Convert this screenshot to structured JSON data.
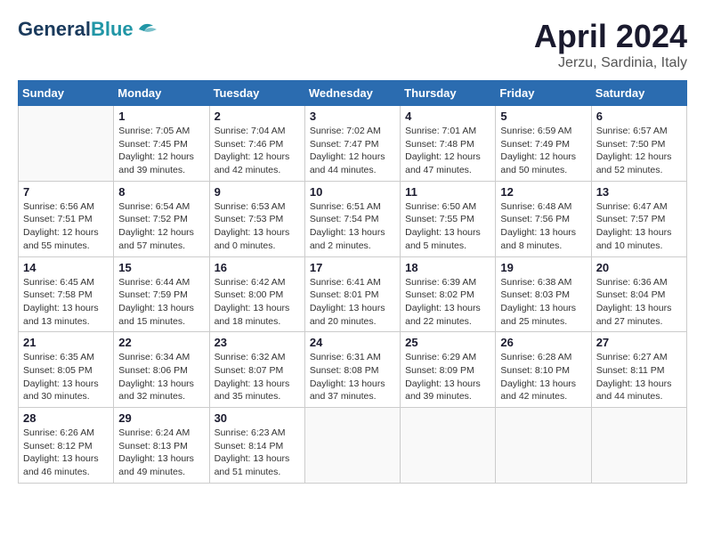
{
  "header": {
    "logo_general": "General",
    "logo_blue": "Blue",
    "month_title": "April 2024",
    "location": "Jerzu, Sardinia, Italy"
  },
  "weekdays": [
    "Sunday",
    "Monday",
    "Tuesday",
    "Wednesday",
    "Thursday",
    "Friday",
    "Saturday"
  ],
  "weeks": [
    [
      {
        "day": "",
        "info": ""
      },
      {
        "day": "1",
        "info": "Sunrise: 7:05 AM\nSunset: 7:45 PM\nDaylight: 12 hours\nand 39 minutes."
      },
      {
        "day": "2",
        "info": "Sunrise: 7:04 AM\nSunset: 7:46 PM\nDaylight: 12 hours\nand 42 minutes."
      },
      {
        "day": "3",
        "info": "Sunrise: 7:02 AM\nSunset: 7:47 PM\nDaylight: 12 hours\nand 44 minutes."
      },
      {
        "day": "4",
        "info": "Sunrise: 7:01 AM\nSunset: 7:48 PM\nDaylight: 12 hours\nand 47 minutes."
      },
      {
        "day": "5",
        "info": "Sunrise: 6:59 AM\nSunset: 7:49 PM\nDaylight: 12 hours\nand 50 minutes."
      },
      {
        "day": "6",
        "info": "Sunrise: 6:57 AM\nSunset: 7:50 PM\nDaylight: 12 hours\nand 52 minutes."
      }
    ],
    [
      {
        "day": "7",
        "info": "Sunrise: 6:56 AM\nSunset: 7:51 PM\nDaylight: 12 hours\nand 55 minutes."
      },
      {
        "day": "8",
        "info": "Sunrise: 6:54 AM\nSunset: 7:52 PM\nDaylight: 12 hours\nand 57 minutes."
      },
      {
        "day": "9",
        "info": "Sunrise: 6:53 AM\nSunset: 7:53 PM\nDaylight: 13 hours\nand 0 minutes."
      },
      {
        "day": "10",
        "info": "Sunrise: 6:51 AM\nSunset: 7:54 PM\nDaylight: 13 hours\nand 2 minutes."
      },
      {
        "day": "11",
        "info": "Sunrise: 6:50 AM\nSunset: 7:55 PM\nDaylight: 13 hours\nand 5 minutes."
      },
      {
        "day": "12",
        "info": "Sunrise: 6:48 AM\nSunset: 7:56 PM\nDaylight: 13 hours\nand 8 minutes."
      },
      {
        "day": "13",
        "info": "Sunrise: 6:47 AM\nSunset: 7:57 PM\nDaylight: 13 hours\nand 10 minutes."
      }
    ],
    [
      {
        "day": "14",
        "info": "Sunrise: 6:45 AM\nSunset: 7:58 PM\nDaylight: 13 hours\nand 13 minutes."
      },
      {
        "day": "15",
        "info": "Sunrise: 6:44 AM\nSunset: 7:59 PM\nDaylight: 13 hours\nand 15 minutes."
      },
      {
        "day": "16",
        "info": "Sunrise: 6:42 AM\nSunset: 8:00 PM\nDaylight: 13 hours\nand 18 minutes."
      },
      {
        "day": "17",
        "info": "Sunrise: 6:41 AM\nSunset: 8:01 PM\nDaylight: 13 hours\nand 20 minutes."
      },
      {
        "day": "18",
        "info": "Sunrise: 6:39 AM\nSunset: 8:02 PM\nDaylight: 13 hours\nand 22 minutes."
      },
      {
        "day": "19",
        "info": "Sunrise: 6:38 AM\nSunset: 8:03 PM\nDaylight: 13 hours\nand 25 minutes."
      },
      {
        "day": "20",
        "info": "Sunrise: 6:36 AM\nSunset: 8:04 PM\nDaylight: 13 hours\nand 27 minutes."
      }
    ],
    [
      {
        "day": "21",
        "info": "Sunrise: 6:35 AM\nSunset: 8:05 PM\nDaylight: 13 hours\nand 30 minutes."
      },
      {
        "day": "22",
        "info": "Sunrise: 6:34 AM\nSunset: 8:06 PM\nDaylight: 13 hours\nand 32 minutes."
      },
      {
        "day": "23",
        "info": "Sunrise: 6:32 AM\nSunset: 8:07 PM\nDaylight: 13 hours\nand 35 minutes."
      },
      {
        "day": "24",
        "info": "Sunrise: 6:31 AM\nSunset: 8:08 PM\nDaylight: 13 hours\nand 37 minutes."
      },
      {
        "day": "25",
        "info": "Sunrise: 6:29 AM\nSunset: 8:09 PM\nDaylight: 13 hours\nand 39 minutes."
      },
      {
        "day": "26",
        "info": "Sunrise: 6:28 AM\nSunset: 8:10 PM\nDaylight: 13 hours\nand 42 minutes."
      },
      {
        "day": "27",
        "info": "Sunrise: 6:27 AM\nSunset: 8:11 PM\nDaylight: 13 hours\nand 44 minutes."
      }
    ],
    [
      {
        "day": "28",
        "info": "Sunrise: 6:26 AM\nSunset: 8:12 PM\nDaylight: 13 hours\nand 46 minutes."
      },
      {
        "day": "29",
        "info": "Sunrise: 6:24 AM\nSunset: 8:13 PM\nDaylight: 13 hours\nand 49 minutes."
      },
      {
        "day": "30",
        "info": "Sunrise: 6:23 AM\nSunset: 8:14 PM\nDaylight: 13 hours\nand 51 minutes."
      },
      {
        "day": "",
        "info": ""
      },
      {
        "day": "",
        "info": ""
      },
      {
        "day": "",
        "info": ""
      },
      {
        "day": "",
        "info": ""
      }
    ]
  ]
}
